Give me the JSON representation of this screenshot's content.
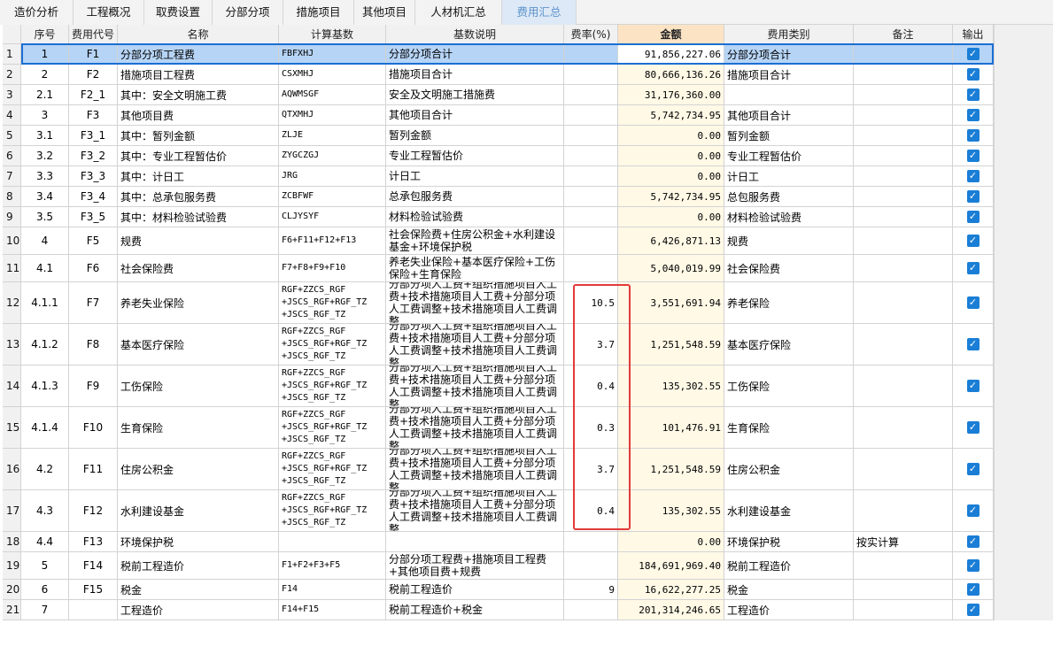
{
  "tabs": [
    {
      "label": "造价分析",
      "active": false
    },
    {
      "label": "工程概况",
      "active": false
    },
    {
      "label": "取费设置",
      "active": false
    },
    {
      "label": "分部分项",
      "active": false
    },
    {
      "label": "措施项目",
      "active": false
    },
    {
      "label": "其他项目",
      "active": false
    },
    {
      "label": "人材机汇总",
      "active": false
    },
    {
      "label": "费用汇总",
      "active": true
    }
  ],
  "columns": [
    "",
    "序号",
    "费用代号",
    "名称",
    "计算基数",
    "基数说明",
    "费率(%)",
    "金额",
    "费用类别",
    "备注",
    "输出"
  ],
  "rows": [
    {
      "n": "1",
      "seq": "1",
      "code": "F1",
      "name": "分部分项工程费",
      "base": "FBFXHJ",
      "desc": "分部分项合计",
      "rate": "",
      "amount": "91,856,227.06",
      "cat": "分部分项合计",
      "note": "",
      "out": true
    },
    {
      "n": "2",
      "seq": "2",
      "code": "F2",
      "name": "措施项目工程费",
      "base": "CSXMHJ",
      "desc": "措施项目合计",
      "rate": "",
      "amount": "80,666,136.26",
      "cat": "措施项目合计",
      "note": "",
      "out": true
    },
    {
      "n": "3",
      "seq": "2.1",
      "code": "F2_1",
      "name": "其中：安全文明施工费",
      "base": "AQWMSGF",
      "desc": "安全及文明施工措施费",
      "rate": "",
      "amount": "31,176,360.00",
      "cat": "",
      "note": "",
      "out": true
    },
    {
      "n": "4",
      "seq": "3",
      "code": "F3",
      "name": "其他项目费",
      "base": "QTXMHJ",
      "desc": "其他项目合计",
      "rate": "",
      "amount": "5,742,734.95",
      "cat": "其他项目合计",
      "note": "",
      "out": true
    },
    {
      "n": "5",
      "seq": "3.1",
      "code": "F3_1",
      "name": "其中：暂列金额",
      "base": "ZLJE",
      "desc": "暂列金额",
      "rate": "",
      "amount": "0.00",
      "cat": "暂列金额",
      "note": "",
      "out": true
    },
    {
      "n": "6",
      "seq": "3.2",
      "code": "F3_2",
      "name": "其中：专业工程暂估价",
      "base": "ZYGCZGJ",
      "desc": "专业工程暂估价",
      "rate": "",
      "amount": "0.00",
      "cat": "专业工程暂估价",
      "note": "",
      "out": true
    },
    {
      "n": "7",
      "seq": "3.3",
      "code": "F3_3",
      "name": "其中：计日工",
      "base": "JRG",
      "desc": "计日工",
      "rate": "",
      "amount": "0.00",
      "cat": "计日工",
      "note": "",
      "out": true
    },
    {
      "n": "8",
      "seq": "3.4",
      "code": "F3_4",
      "name": "其中：总承包服务费",
      "base": "ZCBFWF",
      "desc": "总承包服务费",
      "rate": "",
      "amount": "5,742,734.95",
      "cat": "总包服务费",
      "note": "",
      "out": true
    },
    {
      "n": "9",
      "seq": "3.5",
      "code": "F3_5",
      "name": "其中：材料检验试验费",
      "base": "CLJYSYF",
      "desc": "材料检验试验费",
      "rate": "",
      "amount": "0.00",
      "cat": "材料检验试验费",
      "note": "",
      "out": true
    },
    {
      "n": "10",
      "seq": "4",
      "code": "F5",
      "name": "规费",
      "base": "F6+F11+F12+F13",
      "desc": "社会保险费+住房公积金+水利建设基金+环境保护税",
      "rate": "",
      "amount": "6,426,871.13",
      "cat": "规费",
      "note": "",
      "out": true
    },
    {
      "n": "11",
      "seq": "4.1",
      "code": "F6",
      "name": "社会保险费",
      "base": "F7+F8+F9+F10",
      "desc": "养老失业保险+基本医疗保险+工伤保险+生育保险",
      "rate": "",
      "amount": "5,040,019.99",
      "cat": "社会保险费",
      "note": "",
      "out": true
    },
    {
      "n": "12",
      "seq": "4.1.1",
      "code": "F7",
      "name": "养老失业保险",
      "base": "RGF+ZZCS_RGF +JSCS_RGF+RGF_TZ +JSCS_RGF_TZ",
      "desc": "分部分项人工费+组织措施项目人工费+技术措施项目人工费+分部分项人工费调整+技术措施项目人工费调整",
      "rate": "10.5",
      "amount": "3,551,691.94",
      "cat": "养老保险",
      "note": "",
      "out": true
    },
    {
      "n": "13",
      "seq": "4.1.2",
      "code": "F8",
      "name": "基本医疗保险",
      "base": "RGF+ZZCS_RGF +JSCS_RGF+RGF_TZ +JSCS_RGF_TZ",
      "desc": "分部分项人工费+组织措施项目人工费+技术措施项目人工费+分部分项人工费调整+技术措施项目人工费调整",
      "rate": "3.7",
      "amount": "1,251,548.59",
      "cat": "基本医疗保险",
      "note": "",
      "out": true
    },
    {
      "n": "14",
      "seq": "4.1.3",
      "code": "F9",
      "name": "工伤保险",
      "base": "RGF+ZZCS_RGF +JSCS_RGF+RGF_TZ +JSCS_RGF_TZ",
      "desc": "分部分项人工费+组织措施项目人工费+技术措施项目人工费+分部分项人工费调整+技术措施项目人工费调整",
      "rate": "0.4",
      "amount": "135,302.55",
      "cat": "工伤保险",
      "note": "",
      "out": true
    },
    {
      "n": "15",
      "seq": "4.1.4",
      "code": "F10",
      "name": "生育保险",
      "base": "RGF+ZZCS_RGF +JSCS_RGF+RGF_TZ +JSCS_RGF_TZ",
      "desc": "分部分项人工费+组织措施项目人工费+技术措施项目人工费+分部分项人工费调整+技术措施项目人工费调整",
      "rate": "0.3",
      "amount": "101,476.91",
      "cat": "生育保险",
      "note": "",
      "out": true
    },
    {
      "n": "16",
      "seq": "4.2",
      "code": "F11",
      "name": "住房公积金",
      "base": "RGF+ZZCS_RGF +JSCS_RGF+RGF_TZ +JSCS_RGF_TZ",
      "desc": "分部分项人工费+组织措施项目人工费+技术措施项目人工费+分部分项人工费调整+技术措施项目人工费调整",
      "rate": "3.7",
      "amount": "1,251,548.59",
      "cat": "住房公积金",
      "note": "",
      "out": true
    },
    {
      "n": "17",
      "seq": "4.3",
      "code": "F12",
      "name": "水利建设基金",
      "base": "RGF+ZZCS_RGF +JSCS_RGF+RGF_TZ +JSCS_RGF_TZ",
      "desc": "分部分项人工费+组织措施项目人工费+技术措施项目人工费+分部分项人工费调整+技术措施项目人工费调整",
      "rate": "0.4",
      "amount": "135,302.55",
      "cat": "水利建设基金",
      "note": "",
      "out": true
    },
    {
      "n": "18",
      "seq": "4.4",
      "code": "F13",
      "name": "环境保护税",
      "base": "",
      "desc": "",
      "rate": "",
      "amount": "0.00",
      "cat": "环境保护税",
      "note": "按实计算",
      "out": true
    },
    {
      "n": "19",
      "seq": "5",
      "code": "F14",
      "name": "税前工程造价",
      "base": "F1+F2+F3+F5",
      "desc": "分部分项工程费+措施项目工程费+其他项目费+规费",
      "rate": "",
      "amount": "184,691,969.40",
      "cat": "税前工程造价",
      "note": "",
      "out": true
    },
    {
      "n": "20",
      "seq": "6",
      "code": "F15",
      "name": "税金",
      "base": "F14",
      "desc": "税前工程造价",
      "rate": "9",
      "amount": "16,622,277.25",
      "cat": "税金",
      "note": "",
      "out": true
    },
    {
      "n": "21",
      "seq": "7",
      "code": "",
      "name": "工程造价",
      "base": "F14+F15",
      "desc": "税前工程造价+税金",
      "rate": "",
      "amount": "201,314,246.65",
      "cat": "工程造价",
      "note": "",
      "out": true
    }
  ],
  "selected_row": 1,
  "highlighted_column": "费率(%)",
  "checkbox_glyph": "✓",
  "colors": {
    "accent": "#1a7ed6",
    "selection": "#b6d4f5",
    "amount_header": "#fbe3c4",
    "amount_bg": "#fff9e6",
    "highlight_box": "#e23a3a"
  }
}
